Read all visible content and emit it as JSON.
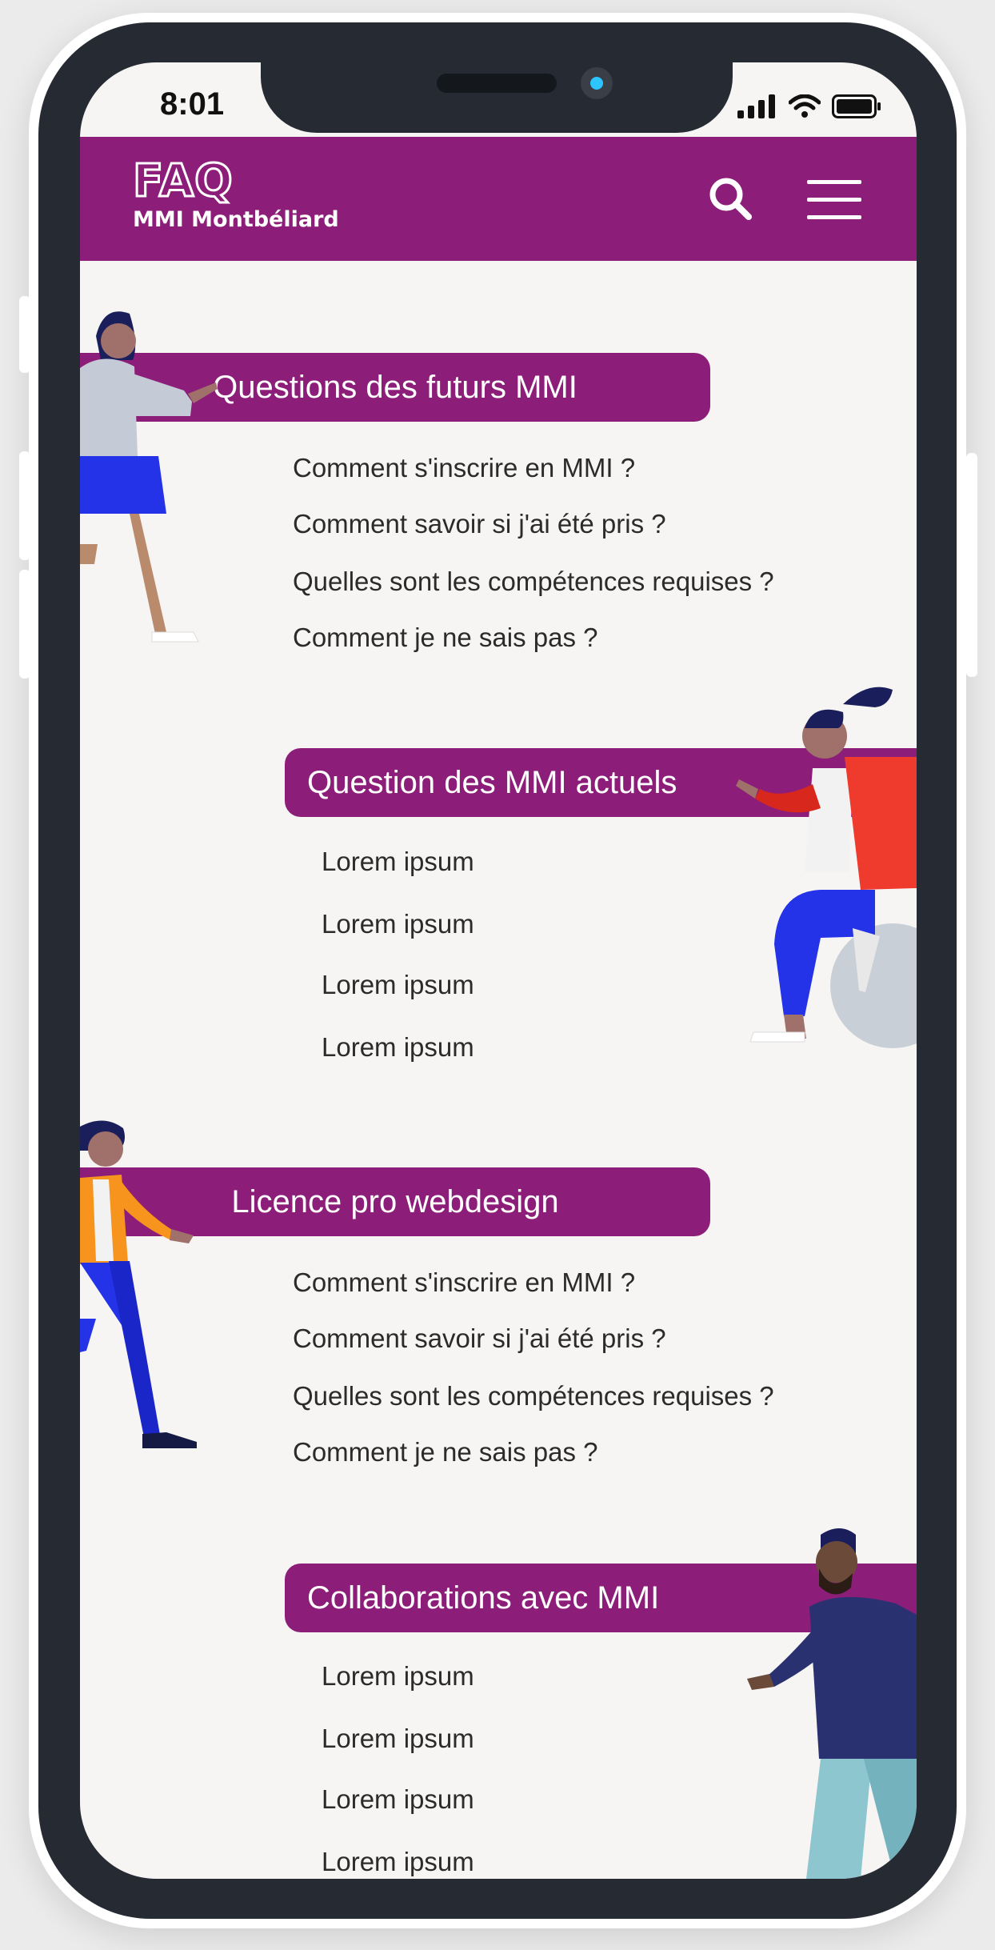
{
  "status_bar": {
    "time": "8:01"
  },
  "header": {
    "logo_title": "FAQ",
    "logo_subtitle": "MMI Montbéliard",
    "search_icon": "search-icon",
    "menu_icon": "hamburger-menu-icon"
  },
  "colors": {
    "brand": "#8c1e79",
    "background": "#f6f5f3",
    "text": "#2b2b2b"
  },
  "sections": [
    {
      "title": "Questions des futurs MMI",
      "items": [
        "Comment s'inscrire en MMI ?",
        "Comment savoir si j'ai été pris ?",
        "Quelles sont les compétences requises ?",
        "Comment je ne sais pas ?"
      ]
    },
    {
      "title": "Question des MMI actuels",
      "items": [
        "Lorem ipsum",
        "Lorem ipsum",
        "Lorem ipsum",
        "Lorem ipsum"
      ]
    },
    {
      "title": "Licence pro webdesign",
      "items": [
        "Comment s'inscrire en MMI ?",
        "Comment savoir si j'ai été pris ?",
        "Quelles sont les compétences requises ?",
        "Comment je ne sais pas ?"
      ]
    },
    {
      "title": "Collaborations avec MMI",
      "items": [
        "Lorem ipsum",
        "Lorem ipsum",
        "Lorem ipsum",
        "Lorem ipsum"
      ]
    }
  ]
}
